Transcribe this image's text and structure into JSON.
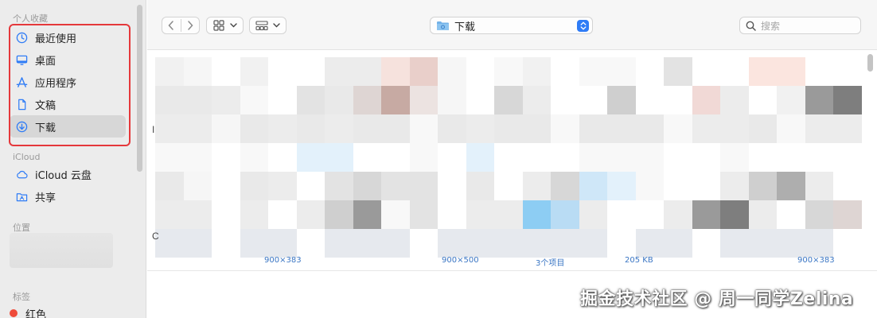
{
  "sidebar": {
    "favorites_title": "个人收藏",
    "favorites": [
      {
        "label": "最近使用",
        "icon": "clock-icon"
      },
      {
        "label": "桌面",
        "icon": "desktop-icon"
      },
      {
        "label": "应用程序",
        "icon": "applications-icon"
      },
      {
        "label": "文稿",
        "icon": "document-icon"
      },
      {
        "label": "下载",
        "icon": "download-icon",
        "selected": true
      }
    ],
    "icloud_title": "iCloud",
    "icloud": [
      {
        "label": "iCloud 云盘",
        "icon": "cloud-icon"
      },
      {
        "label": "共享",
        "icon": "shared-folder-icon"
      }
    ],
    "locations_title": "位置",
    "tags_title": "标签",
    "tags": [
      {
        "label": "红色",
        "color": "#ef4b3a"
      }
    ]
  },
  "toolbar": {
    "path_label": "下载",
    "search_placeholder": "搜索",
    "accent_color": "#2f7cf6"
  },
  "content": {
    "file_meta": [
      "900×383",
      "900×500",
      "3个项目",
      "205 KB",
      "900×383"
    ],
    "edge_marks": [
      "I",
      "C"
    ]
  },
  "highlight_color": "#e5383b",
  "watermark": "掘金技术社区 @ 周一同学Zelina"
}
